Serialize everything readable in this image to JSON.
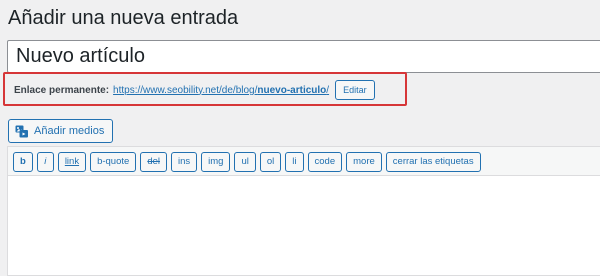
{
  "page": {
    "title": "Añadir una nueva entrada"
  },
  "post_title": {
    "value": "Nuevo artículo"
  },
  "permalink": {
    "label": "Enlace permanente:",
    "url_base": "https://www.seobility.net/de/blog/",
    "slug": "nuevo-articulo",
    "url_trailing": "/",
    "edit_label": "Editar",
    "highlight_color": "#d63638"
  },
  "media": {
    "icon": "add-media-icon",
    "label": "Añadir medios"
  },
  "toolbar": {
    "buttons": [
      "b",
      "i",
      "link",
      "b-quote",
      "del",
      "ins",
      "img",
      "ul",
      "ol",
      "li",
      "code",
      "more",
      "cerrar las etiquetas"
    ]
  },
  "colors": {
    "accent": "#2271b1",
    "background": "#f0f0f1"
  }
}
